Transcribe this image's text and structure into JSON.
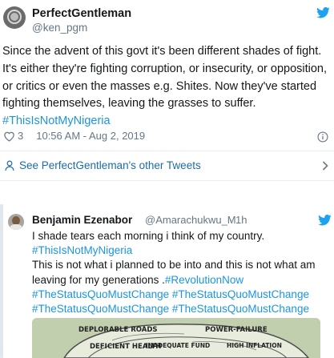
{
  "main_tweet": {
    "display_name": "PerfectGentleman",
    "handle": "@ken_pgm",
    "text_plain": "Since the advent of this govt it's been different shades of fight. It's either they're fighting corruption, or insecurity, or opposition, or critics or even the masses e.g. Shites. Now they've started fighting themselves, leaving the grasses to suffer.",
    "line1": "Since the advent of this govt it's been different shades of fight.",
    "line2": "It's either they're fighting corruption, or insecurity, or opposition,",
    "line3": "or critics or even the masses e.g. Shites. Now they've started",
    "line4": "fighting themselves, leaving the grasses to suffer.",
    "hashtag": "#ThisIsNotMyNigeria",
    "likes": "3",
    "timestamp": "10:56 AM - Aug 2, 2019"
  },
  "see_more": {
    "label": "See PerfectGentleman's other Tweets"
  },
  "quoted_tweet": {
    "display_name": "Benjamin Ezenabor",
    "handle": "@Amarachukwu_M",
    "separator": "·",
    "time": "1h",
    "line1": "I shade tears each morning i think of my country.",
    "line2": "#ThisIsNotMyNigeria",
    "line3": "This is not what i planned to be into and this is not what am",
    "line4a": "leaving for my generations .",
    "line4b": "#RevolutionNow",
    "line5": "#TheStatusQuoMustChange #TheStatusQuoMustChange",
    "line6": "#TheStatusQuoMustChange #TheStatusQuoMustChange",
    "image_labels": {
      "deplorable_roads": "DEPLORABLE ROADS",
      "power_failure": "POWER-FAILURE",
      "deficient_health": "DEFICIENT HEALTH",
      "inadequate_fund": "INADEQUATE FUND",
      "high_inflation": "HIGH INFLATION"
    }
  },
  "colors": {
    "twitter_blue": "#1da1f2",
    "link_blue": "#1b95e0",
    "muted": "#657786",
    "text": "#14171a",
    "divider": "#e6ecf0"
  },
  "icons": [
    "twitter-bird-icon",
    "heart-icon",
    "info-icon",
    "person-icon",
    "chevron-right-icon"
  ]
}
